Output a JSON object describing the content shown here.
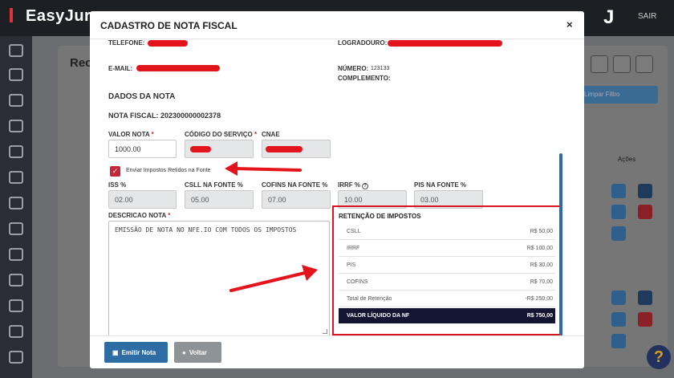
{
  "app": {
    "brand": "EasyJur",
    "user_initial": "J",
    "logout_label": "SAIR",
    "page_title": "Rec",
    "filter_button": "Limpar Filtro",
    "actions_header": "Ações",
    "help": "?"
  },
  "modal": {
    "title": "CADASTRO DE NOTA FISCAL",
    "close_label": "×",
    "contact": {
      "telefone_label": "TELEFONE:",
      "email_label": "E-MAIL:",
      "logradouro_label": "LOGRADOURO:",
      "numero_label": "NÚMERO:",
      "numero_value": "123133",
      "complemento_label": "COMPLEMENTO:"
    },
    "section_title": "DADOS DA NOTA",
    "nota_fiscal_label": "NOTA FISCAL: 202300000002378",
    "fields": {
      "valor_nota_label": "VALOR NOTA",
      "valor_nota_value": "1000.00",
      "codigo_servico_label": "CÓDIGO DO SERVIÇO",
      "cnae_label": "CNAE",
      "required_mark": "*"
    },
    "checkbox_label": "Enviar Impostos Retidos na Fonte",
    "rates": [
      {
        "label": "ISS %",
        "value": "02.00"
      },
      {
        "label": "CSLL NA FONTE %",
        "value": "05.00"
      },
      {
        "label": "COFINS NA FONTE %",
        "value": "07.00"
      },
      {
        "label": "IRRF %",
        "value": "10.00"
      },
      {
        "label": "PIS NA FONTE %",
        "value": "03.00"
      }
    ],
    "descricao_label": "DESCRICAO NOTA",
    "descricao_value": "EMISSÃO DE NOTA NO NFE.IO COM TODOS OS IMPOSTOS",
    "retencao": {
      "title": "RETENÇÃO DE IMPOSTOS",
      "rows": [
        {
          "label": "CSLL",
          "value": "R$ 50,00"
        },
        {
          "label": "IRRF",
          "value": "R$ 100,00"
        },
        {
          "label": "PIS",
          "value": "R$ 30,00"
        },
        {
          "label": "COFINS",
          "value": "R$ 70,00"
        },
        {
          "label": "Total de Retenção",
          "value": "-R$ 250,00"
        }
      ],
      "liquido_label": "VALOR LÍQUIDO DA NF",
      "liquido_value": "R$ 750,00"
    },
    "buttons": {
      "emitir_label": "Emitir Nota",
      "voltar_label": "Voltar"
    }
  },
  "colors": {
    "primary": "#2e6da4",
    "danger": "#d9161f",
    "dark_total": "#131533",
    "checkbox": "#c8253a"
  }
}
